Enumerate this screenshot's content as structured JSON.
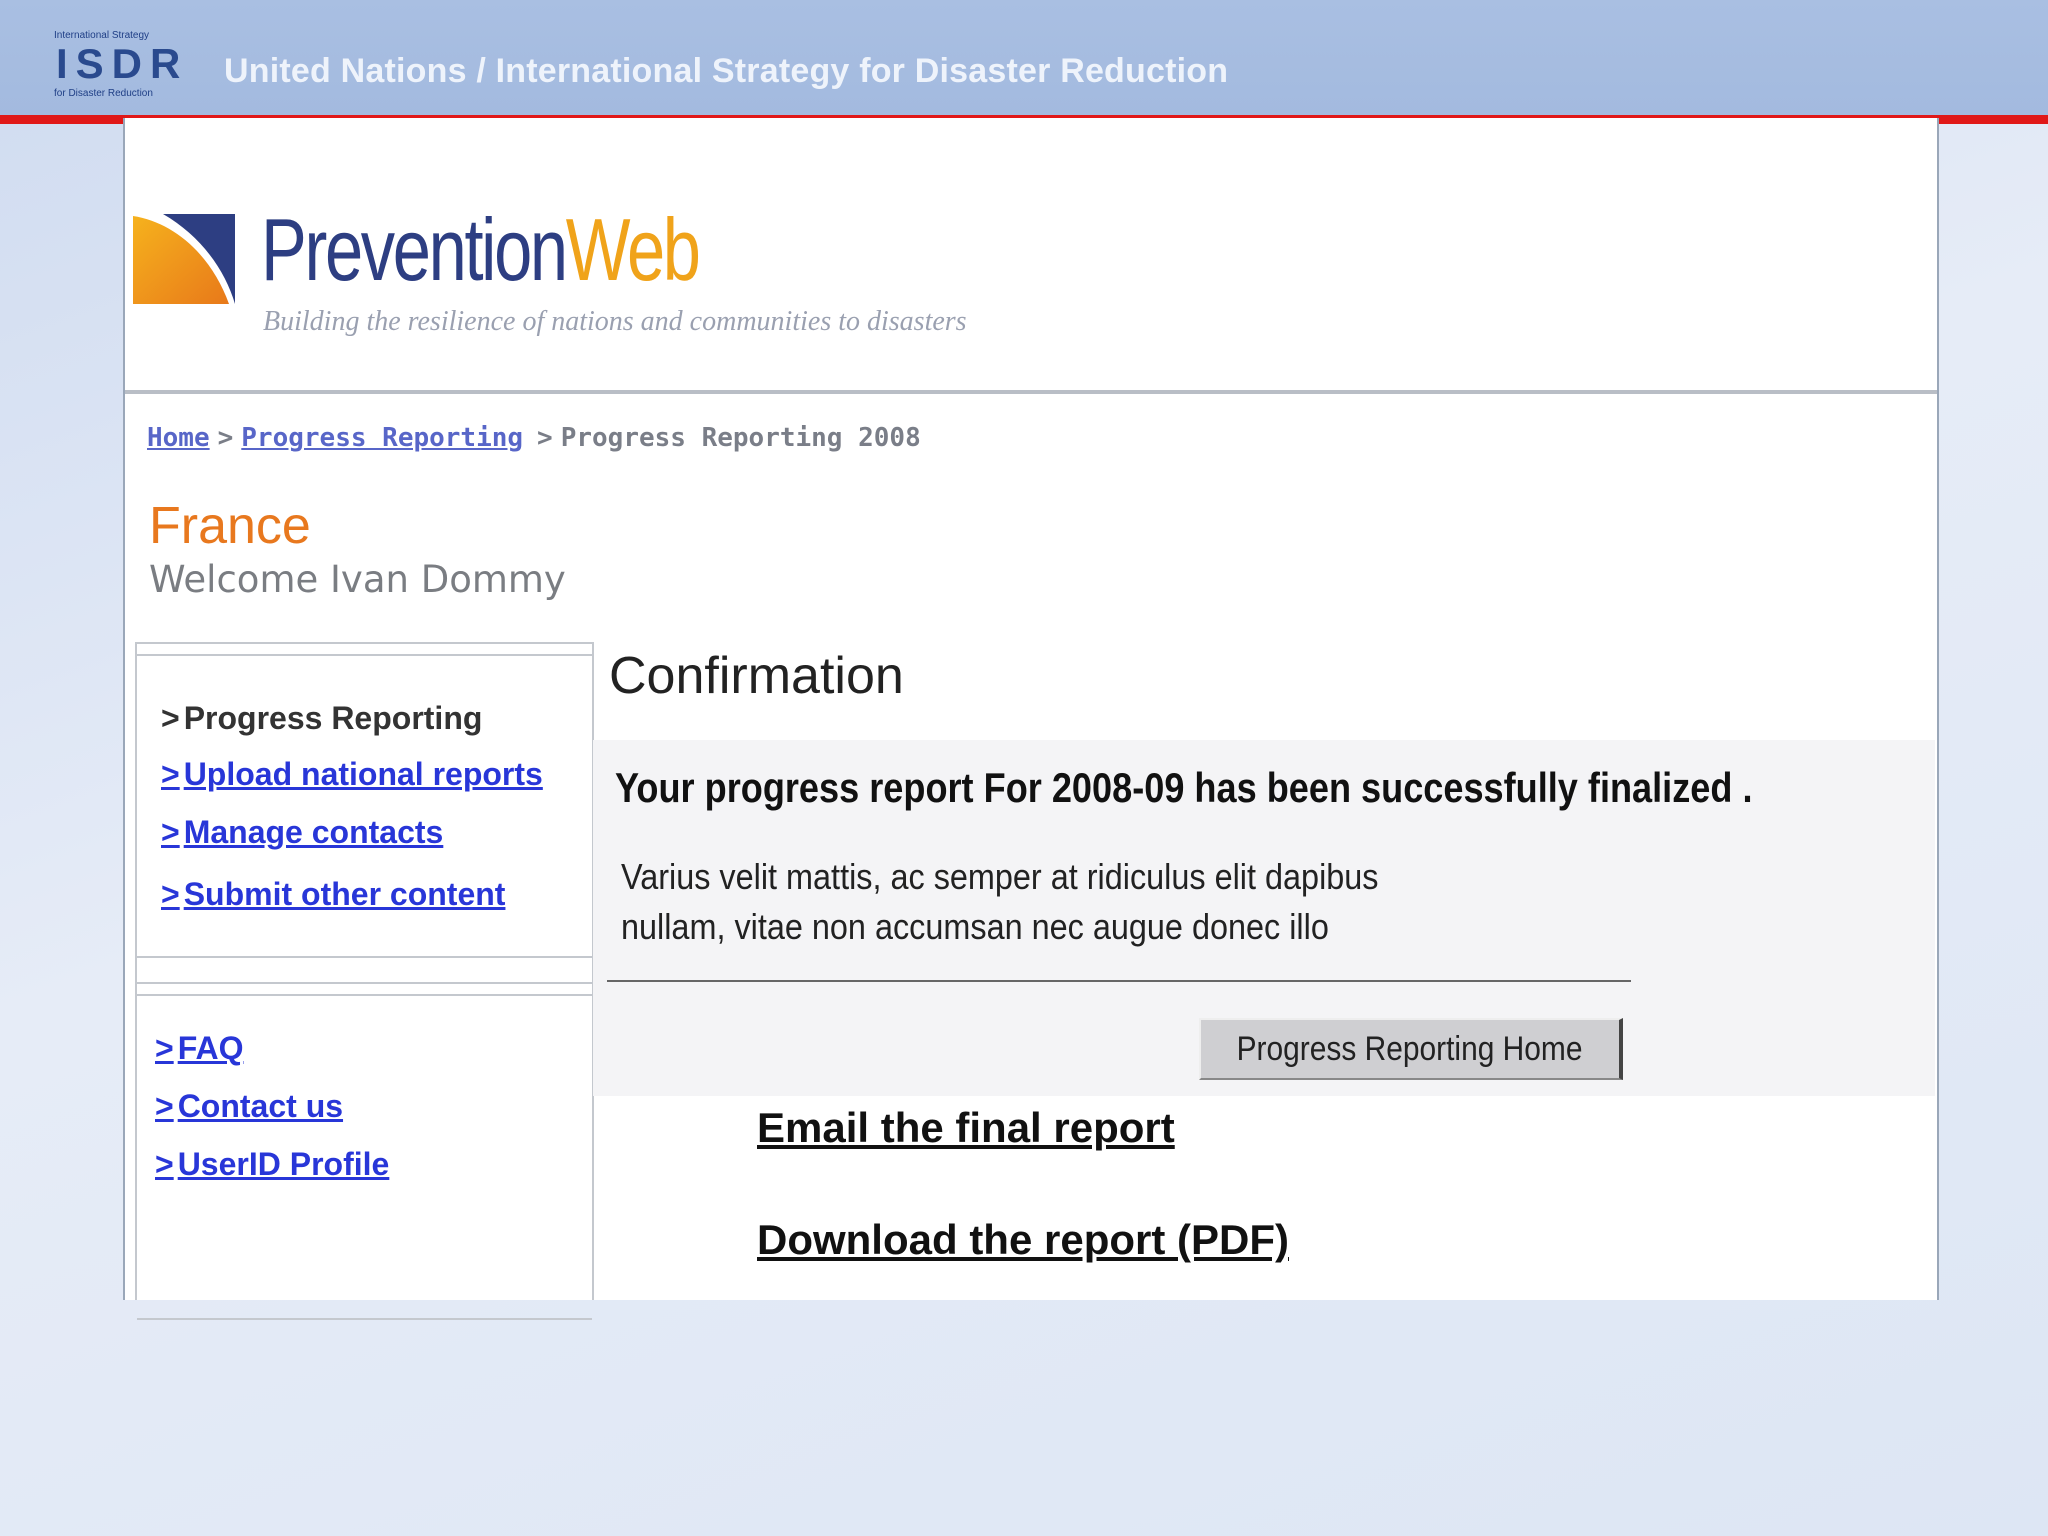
{
  "header": {
    "org_logo_text": "ISDR",
    "org_logo_small_top": "International Strategy",
    "org_logo_small_bottom": "for Disaster Reduction",
    "title": "United Nations / International Strategy for Disaster Reduction"
  },
  "site": {
    "logo_word_1": "Prevention",
    "logo_word_2": "Web",
    "tagline": "Building the resilience of nations and communities to disasters"
  },
  "breadcrumb": {
    "items": [
      "Home",
      "Progress Reporting",
      "Progress Reporting 2008"
    ],
    "separator": ">"
  },
  "user": {
    "country": "France",
    "welcome": "Welcome Ivan Dommy"
  },
  "sidebar": {
    "section1": [
      {
        "label": "Progress Reporting"
      },
      {
        "label": "Upload national reports"
      },
      {
        "label": "Manage contacts"
      },
      {
        "label": "Submit other content"
      }
    ],
    "section2": [
      {
        "label": "FAQ"
      },
      {
        "label": "Contact us"
      },
      {
        "label": "UserID Profile"
      }
    ],
    "arrow": ">"
  },
  "main": {
    "title": "Confirmation",
    "success_message": "Your progress report  For 2008-09 has been successfully finalized .",
    "body_line_1": "Varius velit mattis, ac semper at ridiculus elit dapibus",
    "body_line_2": "nullam, vitae non accumsan nec augue donec illo",
    "home_button": "Progress Reporting Home",
    "email_link": "Email the final report",
    "download_link": "Download the report (PDF)"
  },
  "colors": {
    "topbar": "#a9bfe2",
    "redline": "#e01818",
    "brand_blue": "#2d3e82",
    "brand_orange": "#f0a31a",
    "country_orange": "#e8781e",
    "link_blue": "#2836d8"
  }
}
